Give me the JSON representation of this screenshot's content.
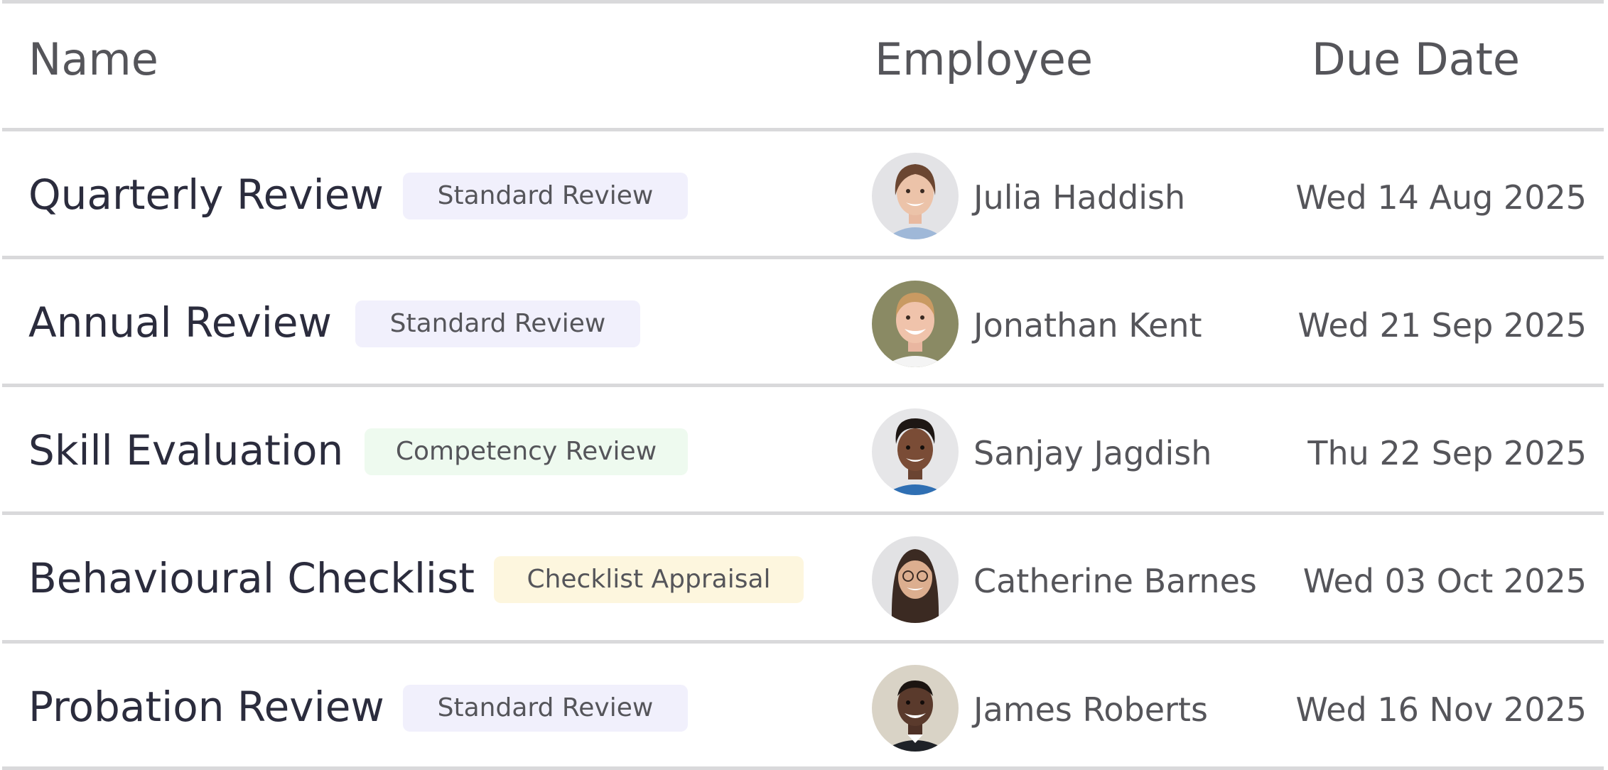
{
  "table": {
    "headers": {
      "name": "Name",
      "employee": "Employee",
      "due_date": "Due Date"
    },
    "rows": [
      {
        "name": "Quarterly Review",
        "type": "Standard Review",
        "employee": "Julia Haddish",
        "due_date": "Wed 14 Aug 2025"
      },
      {
        "name": "Annual Review",
        "type": "Standard Review",
        "employee": "Jonathan Kent",
        "due_date": "Wed 21 Sep 2025"
      },
      {
        "name": "Skill Evaluation",
        "type": "Competency Review",
        "employee": "Sanjay Jagdish",
        "due_date": "Thu 22 Sep 2025"
      },
      {
        "name": "Behavioural Checklist",
        "type": "Checklist Appraisal",
        "employee": "Catherine Barnes",
        "due_date": "Wed 03 Oct 2025"
      },
      {
        "name": "Probation Review",
        "type": "Standard Review",
        "employee": "James Roberts",
        "due_date": "Wed 16 Nov 2025"
      }
    ]
  },
  "colors": {
    "text_primary": "#2b2c3d",
    "text_secondary": "#55555a",
    "divider": "#d9d9db",
    "badge_standard": "#f1f0fc",
    "badge_competency": "#eefaef",
    "badge_checklist": "#fdf6de"
  }
}
